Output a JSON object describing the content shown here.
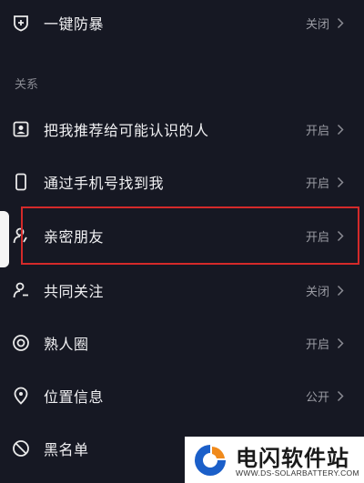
{
  "section": {
    "title": "关系"
  },
  "rows": [
    {
      "label": "一键防暴",
      "value": "关闭",
      "icon": "shield-plus-icon"
    },
    {
      "label": "把我推荐给可能认识的人",
      "value": "开启",
      "icon": "contact-card-icon"
    },
    {
      "label": "通过手机号找到我",
      "value": "开启",
      "icon": "phone-icon"
    },
    {
      "label": "亲密朋友",
      "value": "开启",
      "icon": "close-friend-icon"
    },
    {
      "label": "共同关注",
      "value": "关闭",
      "icon": "mutual-follow-icon"
    },
    {
      "label": "熟人圈",
      "value": "开启",
      "icon": "circle-target-icon"
    },
    {
      "label": "位置信息",
      "value": "公开",
      "icon": "location-pin-icon"
    },
    {
      "label": "黑名单",
      "value": "",
      "icon": "block-icon"
    }
  ],
  "watermark": {
    "title": "电闪软件站",
    "url": "WWW.DS-SOLARBATTERY.COM"
  },
  "colors": {
    "background": "#161823",
    "highlight": "#d42a2a",
    "secondary_text": "#9a9ba3"
  }
}
